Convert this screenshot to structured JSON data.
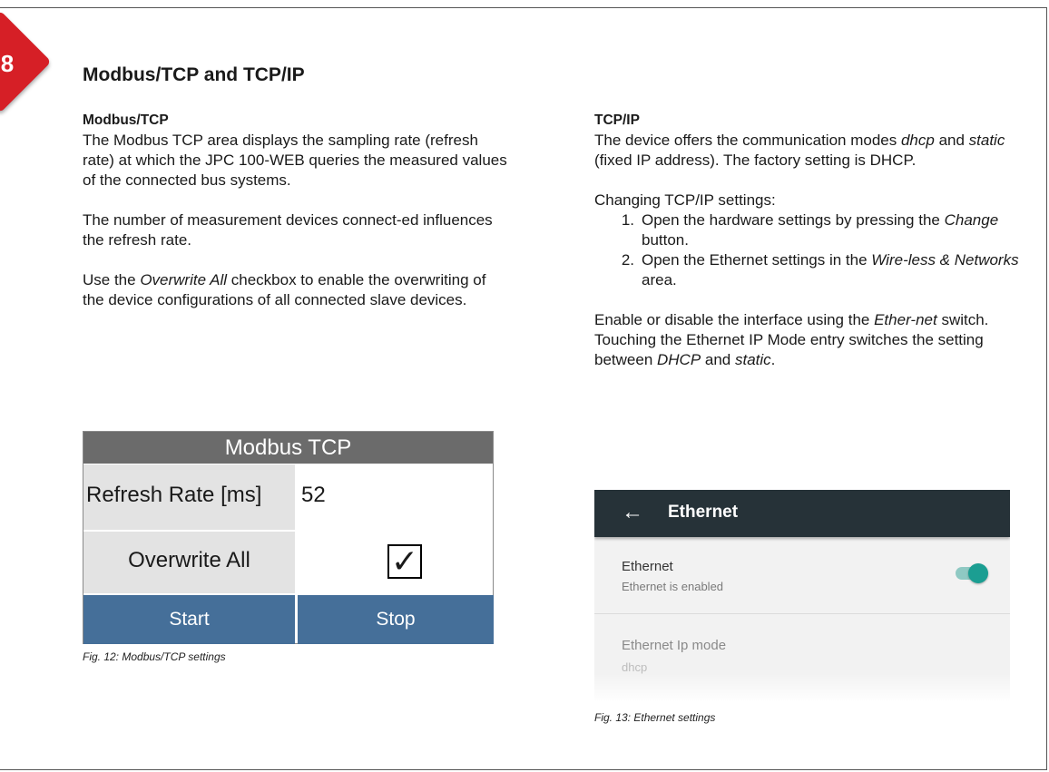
{
  "chapter": "8",
  "page_title": "Modbus/TCP and TCP/IP",
  "left": {
    "heading": "Modbus/TCP",
    "p1": "The Modbus TCP area displays the sampling rate (refresh rate) at which the JPC 100-WEB queries the measured values of the connected bus systems.",
    "p2": "The number of measurement devices connect-ed influences the refresh rate.",
    "p3_a": "Use the ",
    "p3_em": "Overwrite All",
    "p3_b": " checkbox to enable the overwriting of the device configurations of all connected slave devices."
  },
  "right": {
    "heading": "TCP/IP",
    "p1_a": "The device offers the communication modes ",
    "p1_em1": "dhcp",
    "p1_b": " and ",
    "p1_em2": "static",
    "p1_c": " (fixed IP address). The factory setting is DHCP.",
    "changing": "Changing TCP/IP settings:",
    "step1_num": "1.",
    "step1_a": "Open the hardware settings by pressing the ",
    "step1_em": "Change",
    "step1_b": " button.",
    "step2_num": "2.",
    "step2_a": "Open the Ethernet settings in the ",
    "step2_em": "Wire-less & Networks",
    "step2_b": " area.",
    "p3_a": "Enable or disable the interface using the ",
    "p3_em": "Ether-net",
    "p3_b": " switch.",
    "p4_a": "Touching the Ethernet IP Mode entry switches the setting between ",
    "p4_em1": "DHCP",
    "p4_b": " and ",
    "p4_em2": "static",
    "p4_c": "."
  },
  "modbus_widget": {
    "title": "Modbus TCP",
    "refresh_label": "Refresh Rate [ms]",
    "refresh_value": "52",
    "overwrite_label": "Overwrite All",
    "overwrite_checked": true,
    "check_mark": "✓",
    "start_label": "Start",
    "stop_label": "Stop"
  },
  "fig12_caption": "Fig. 12:  Modbus/TCP settings",
  "ethernet_widget": {
    "back_icon": "arrow-left-icon",
    "back_glyph": "←",
    "title": "Ethernet",
    "item1_title": "Ethernet",
    "item1_subtitle": "Ethernet is enabled",
    "item1_toggle_on": true,
    "item2_title": "Ethernet Ip mode",
    "item2_subtitle": "dhcp"
  },
  "fig13_caption": "Fig. 13:  Ethernet settings",
  "colors": {
    "badge": "#d61f26",
    "modbus_header": "#6b6b6b",
    "modbus_button": "#456f99",
    "ethernet_bar": "#263238",
    "toggle": "#1b9e92"
  }
}
